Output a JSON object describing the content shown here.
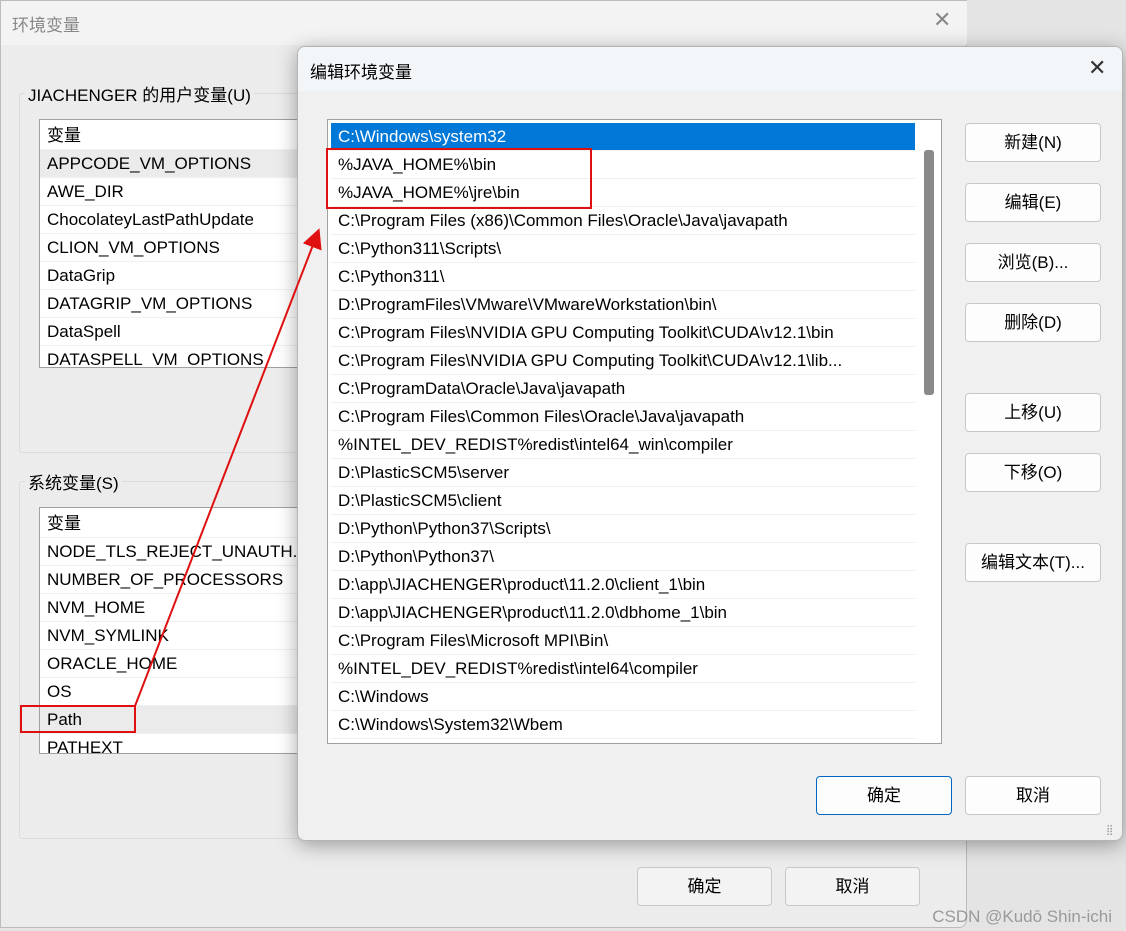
{
  "background_dialog": {
    "title": "环境变量",
    "user_group_label": "JIACHENGER 的用户变量(U)",
    "user_list": {
      "header": "变量",
      "rows": [
        "APPCODE_VM_OPTIONS",
        "AWE_DIR",
        "ChocolateyLastPathUpdate",
        "CLION_VM_OPTIONS",
        "DataGrip",
        "DATAGRIP_VM_OPTIONS",
        "DataSpell",
        "DATASPELL_VM_OPTIONS"
      ]
    },
    "system_group_label": "系统变量(S)",
    "system_list": {
      "header": "变量",
      "rows": [
        "NODE_TLS_REJECT_UNAUTH...",
        "NUMBER_OF_PROCESSORS",
        "NVM_HOME",
        "NVM_SYMLINK",
        "ORACLE_HOME",
        "OS",
        "Path",
        "PATHEXT"
      ],
      "selected": "Path"
    },
    "ok_label": "确定",
    "cancel_label": "取消"
  },
  "edit_dialog": {
    "title": "编辑环境变量",
    "entries": [
      "C:\\Windows\\system32",
      "%JAVA_HOME%\\bin",
      "%JAVA_HOME%\\jre\\bin",
      "C:\\Program Files (x86)\\Common Files\\Oracle\\Java\\javapath",
      "C:\\Python311\\Scripts\\",
      "C:\\Python311\\",
      "D:\\ProgramFiles\\VMware\\VMwareWorkstation\\bin\\",
      "C:\\Program Files\\NVIDIA GPU Computing Toolkit\\CUDA\\v12.1\\bin",
      "C:\\Program Files\\NVIDIA GPU Computing Toolkit\\CUDA\\v12.1\\lib...",
      "C:\\ProgramData\\Oracle\\Java\\javapath",
      "C:\\Program Files\\Common Files\\Oracle\\Java\\javapath",
      "%INTEL_DEV_REDIST%redist\\intel64_win\\compiler",
      "D:\\PlasticSCM5\\server",
      "D:\\PlasticSCM5\\client",
      "D:\\Python\\Python37\\Scripts\\",
      "D:\\Python\\Python37\\",
      "D:\\app\\JIACHENGER\\product\\11.2.0\\client_1\\bin",
      "D:\\app\\JIACHENGER\\product\\11.2.0\\dbhome_1\\bin",
      "C:\\Program Files\\Microsoft MPI\\Bin\\",
      "%INTEL_DEV_REDIST%redist\\intel64\\compiler",
      "C:\\Windows",
      "C:\\Windows\\System32\\Wbem"
    ],
    "selected": "C:\\Windows\\system32",
    "buttons": {
      "new": "新建(N)",
      "edit": "编辑(E)",
      "browse": "浏览(B)...",
      "delete": "删除(D)",
      "up": "上移(U)",
      "down": "下移(O)",
      "edit_text": "编辑文本(T)..."
    },
    "ok_label": "确定",
    "cancel_label": "取消",
    "selection_color": "#0078d7"
  },
  "annotation_color": "#e01010",
  "watermark": "CSDN @Kudō Shin-ichi"
}
